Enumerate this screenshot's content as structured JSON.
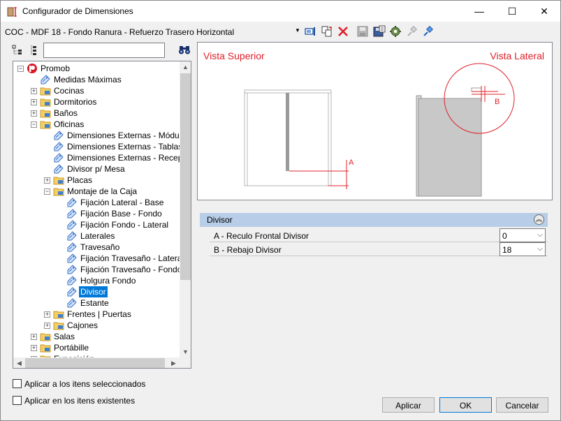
{
  "window": {
    "title": "Configurador de Dimensiones",
    "controls": {
      "minimize": "—",
      "maximize": "☐",
      "close": "✕"
    }
  },
  "toolbar": {
    "config_label": "COC - MDF 18 - Fondo Ranura - Refuerzo Trasero Horizontal",
    "icons": [
      "dropdown-arrow-icon",
      "move-icon",
      "copy-icon",
      "delete-icon",
      "save-icon",
      "save-as-icon",
      "settings-icon",
      "pin-gray-icon",
      "pin-icon"
    ]
  },
  "search": {
    "value": "",
    "placeholder": ""
  },
  "tree": {
    "items": [
      {
        "label": "Promob",
        "level": 0,
        "expander": "minus",
        "icon": "promob-logo-icon"
      },
      {
        "label": "Medidas Máximas",
        "level": 1,
        "expander": "",
        "icon": "tag-icon"
      },
      {
        "label": "Cocinas",
        "level": 1,
        "expander": "plus",
        "icon": "folder-icon"
      },
      {
        "label": "Dormitorios",
        "level": 1,
        "expander": "plus",
        "icon": "folder-icon"
      },
      {
        "label": "Baños",
        "level": 1,
        "expander": "plus",
        "icon": "folder-icon"
      },
      {
        "label": "Oficinas",
        "level": 1,
        "expander": "minus",
        "icon": "folder-icon"
      },
      {
        "label": "Dimensiones Externas - Módulos",
        "level": 2,
        "expander": "",
        "icon": "tag-icon"
      },
      {
        "label": "Dimensiones Externas - Tablas",
        "level": 2,
        "expander": "",
        "icon": "tag-icon"
      },
      {
        "label": "Dimensiones Externas - Recepción",
        "level": 2,
        "expander": "",
        "icon": "tag-icon"
      },
      {
        "label": "Divisor p/ Mesa",
        "level": 2,
        "expander": "",
        "icon": "tag-icon"
      },
      {
        "label": "Placas",
        "level": 2,
        "expander": "plus",
        "icon": "folder-icon"
      },
      {
        "label": "Montaje de la Caja",
        "level": 2,
        "expander": "minus",
        "icon": "folder-icon"
      },
      {
        "label": "Fijación Lateral - Base",
        "level": 3,
        "expander": "",
        "icon": "tag-icon"
      },
      {
        "label": " Fijación Base - Fondo",
        "level": 3,
        "expander": "",
        "icon": "tag-icon"
      },
      {
        "label": "Fijación Fondo - Lateral",
        "level": 3,
        "expander": "",
        "icon": "tag-icon"
      },
      {
        "label": "Laterales",
        "level": 3,
        "expander": "",
        "icon": "tag-icon"
      },
      {
        "label": "Travesaño",
        "level": 3,
        "expander": "",
        "icon": "tag-icon"
      },
      {
        "label": "Fijación Travesaño - Lateral",
        "level": 3,
        "expander": "",
        "icon": "tag-icon"
      },
      {
        "label": "Fijación Travesaño - Fondo",
        "level": 3,
        "expander": "",
        "icon": "tag-icon"
      },
      {
        "label": "Holgura Fondo",
        "level": 3,
        "expander": "",
        "icon": "tag-icon"
      },
      {
        "label": "Divisor",
        "level": 3,
        "expander": "",
        "icon": "tag-icon",
        "selected": true
      },
      {
        "label": "Estante",
        "level": 3,
        "expander": "",
        "icon": "tag-icon"
      },
      {
        "label": "Frentes | Puertas",
        "level": 2,
        "expander": "plus",
        "icon": "folder-icon"
      },
      {
        "label": "Cajones",
        "level": 2,
        "expander": "plus",
        "icon": "folder-icon"
      },
      {
        "label": "Salas",
        "level": 1,
        "expander": "plus",
        "icon": "folder-icon"
      },
      {
        "label": "Portábille",
        "level": 1,
        "expander": "plus",
        "icon": "folder-icon"
      },
      {
        "label": "Exposición",
        "level": 1,
        "expander": "plus",
        "icon": "folder-icon"
      }
    ]
  },
  "preview": {
    "top_view_label": "Vista Superior",
    "side_view_label": "Vista Lateral",
    "marker_a": "A",
    "marker_b": "B",
    "accent_color": "#e0202a"
  },
  "properties": {
    "group_title": "Divisor",
    "rows": [
      {
        "label": "A - Reculo Frontal Divisor",
        "value": "0"
      },
      {
        "label": "B - Rebajo Divisor",
        "value": "18"
      }
    ]
  },
  "options": {
    "apply_selected": "Aplicar a los itens seleccionados",
    "apply_existing": "Aplicar en los itens existentes"
  },
  "buttons": {
    "apply": "Aplicar",
    "ok": "OK",
    "cancel": "Cancelar"
  }
}
